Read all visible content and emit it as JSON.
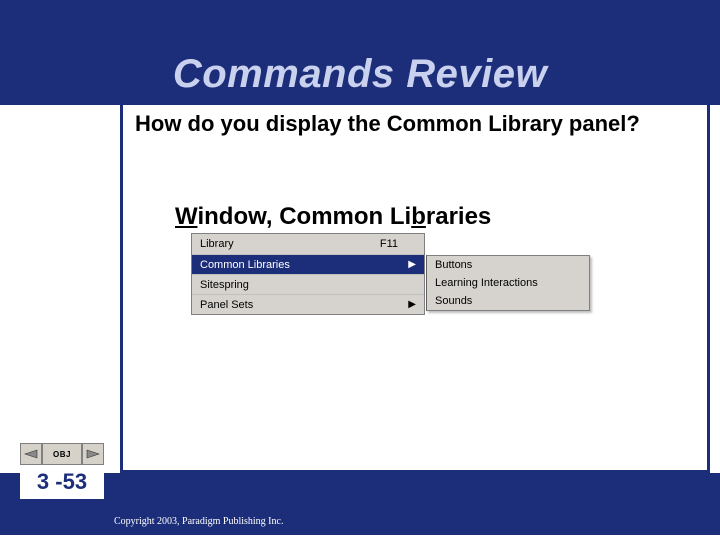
{
  "title": "Commands Review",
  "question": "How do you display the Common Library panel?",
  "answer_pre_w": "W",
  "answer_mid": "indow, Common Li",
  "answer_b": "b",
  "answer_post": "raries",
  "menu": {
    "library": {
      "label": "Library",
      "shortcut": "F11"
    },
    "common_libraries": {
      "label": "Common Libraries"
    },
    "sitespring": {
      "label": "Sitespring"
    },
    "panel_sets": {
      "label": "Panel Sets"
    }
  },
  "submenu": {
    "buttons": "Buttons",
    "learning": "Learning Interactions",
    "sounds": "Sounds"
  },
  "nav": {
    "obj": "OBJ"
  },
  "slide_number": "3 -53",
  "copyright": "Copyright 2003, Paradigm Publishing Inc."
}
